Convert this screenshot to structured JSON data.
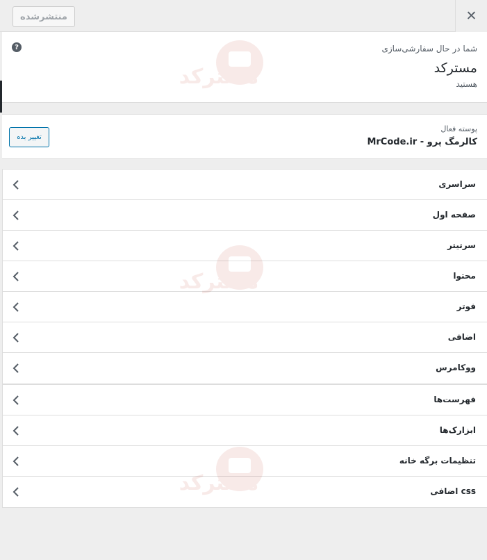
{
  "topbar": {
    "publish_label": "منتشرشده",
    "close_label": "✕"
  },
  "info": {
    "help_label": "?",
    "pre_text": "شما در حال سفارشی‌سازی",
    "site_title": "مسترکد",
    "post_text": "هستید"
  },
  "theme": {
    "label": "پوسته فعال",
    "name": "کالرمگ پرو - MrCode.ir",
    "change_label": "تغییر بده"
  },
  "sections": [
    {
      "label": "سراسری"
    },
    {
      "label": "صفحه اول"
    },
    {
      "label": "سرتیتر"
    },
    {
      "label": "محتوا"
    },
    {
      "label": "فوتر"
    },
    {
      "label": "اضافی"
    },
    {
      "label": "ووکامرس"
    }
  ],
  "extra_sections": [
    {
      "label": "فهرست‌ها"
    },
    {
      "label": "ابزارک‌ها"
    },
    {
      "label": "تنظیمات برگه خانه"
    },
    {
      "label": "css اضافی"
    }
  ],
  "watermark_text": "مسترکد",
  "colors": {
    "accent": "#0073aa",
    "watermark": "#c0392b",
    "panel_bg": "#eeeeee"
  },
  "icons": {
    "close": "close-icon",
    "help": "help-icon",
    "chevron": "chevron-left-icon"
  }
}
